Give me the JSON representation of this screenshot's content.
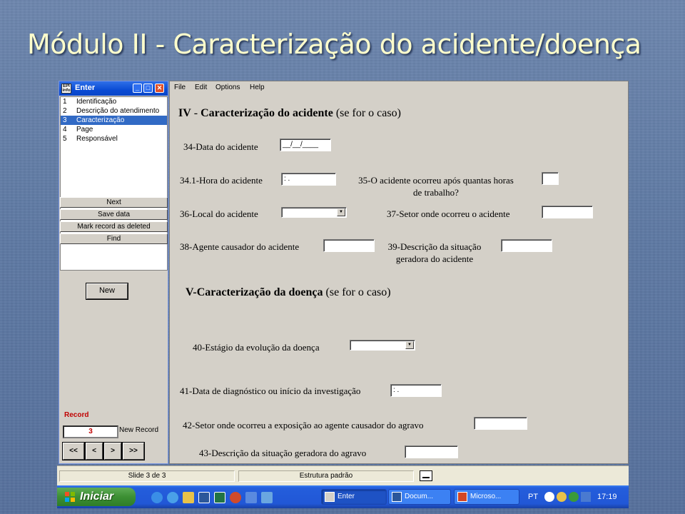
{
  "slide": {
    "title": "Módulo II - Caracterização do acidente/doença"
  },
  "left_window": {
    "title": "Enter",
    "nav_items": [
      {
        "num": "1",
        "label": "Identificação"
      },
      {
        "num": "2",
        "label": "Descrição do atendimento"
      },
      {
        "num": "3",
        "label": "Caracterização",
        "selected": true
      },
      {
        "num": "4",
        "label": "Page"
      },
      {
        "num": "5",
        "label": "Responsável"
      }
    ],
    "buttons": {
      "next": "Next",
      "save": "Save data",
      "mark_deleted": "Mark record as deleted",
      "find": "Find"
    },
    "new_button": "New",
    "record_label": "Record",
    "record_value": "3",
    "new_record_label": "New Record",
    "nav": {
      "first": "<<",
      "prev": "<",
      "next": ">",
      "last": ">>"
    }
  },
  "menu": {
    "file": "File",
    "edit": "Edit",
    "options": "Options",
    "help": "Help"
  },
  "form": {
    "section_iv_bold": "IV",
    "section_iv_sep": " - ",
    "section_iv_title": "Caracterização do acidente ",
    "section_iv_paren": "(se for o caso)",
    "q34_label": "34-Data do acidente",
    "q34_value": "__/__/____",
    "q34_1_label": "34.1-Hora do acidente",
    "q34_1_value": ": .",
    "q35_label": "35-O acidente ocorreu após quantas horas de trabalho?",
    "q36_label": "36-Local do acidente",
    "q37_label": "37-Setor onde ocorreu o acidente",
    "q38_label": "38-Agente causador do acidente",
    "q39_label": "39-Descrição da situação geradora do acidente",
    "section_v_title": "V-Caracterização da doença ",
    "section_v_paren": "(se for o caso)",
    "q40_label": "40-Estágio da evolução da doença",
    "q41_label": "41-Data de diagnóstico ou início da investigação",
    "q41_value": ": .",
    "q42_label": "42-Setor onde ocorreu a exposição ao agente causador do agravo",
    "q43_label": "43-Descrição da situação geradora do agravo"
  },
  "statusbar": {
    "slide": "Slide 3 de 3",
    "design": "Estrutura padrão"
  },
  "taskbar": {
    "start": "Iniciar",
    "tasks": [
      {
        "label": "Enter",
        "active": true
      },
      {
        "label": "Docum..."
      },
      {
        "label": "Microso..."
      }
    ],
    "lang": "PT",
    "clock": "17:19"
  },
  "colors": {
    "title": "#ffffcc",
    "slide_bg": "#5e79a3",
    "selection": "#316ac5",
    "record_red": "#c00000"
  }
}
